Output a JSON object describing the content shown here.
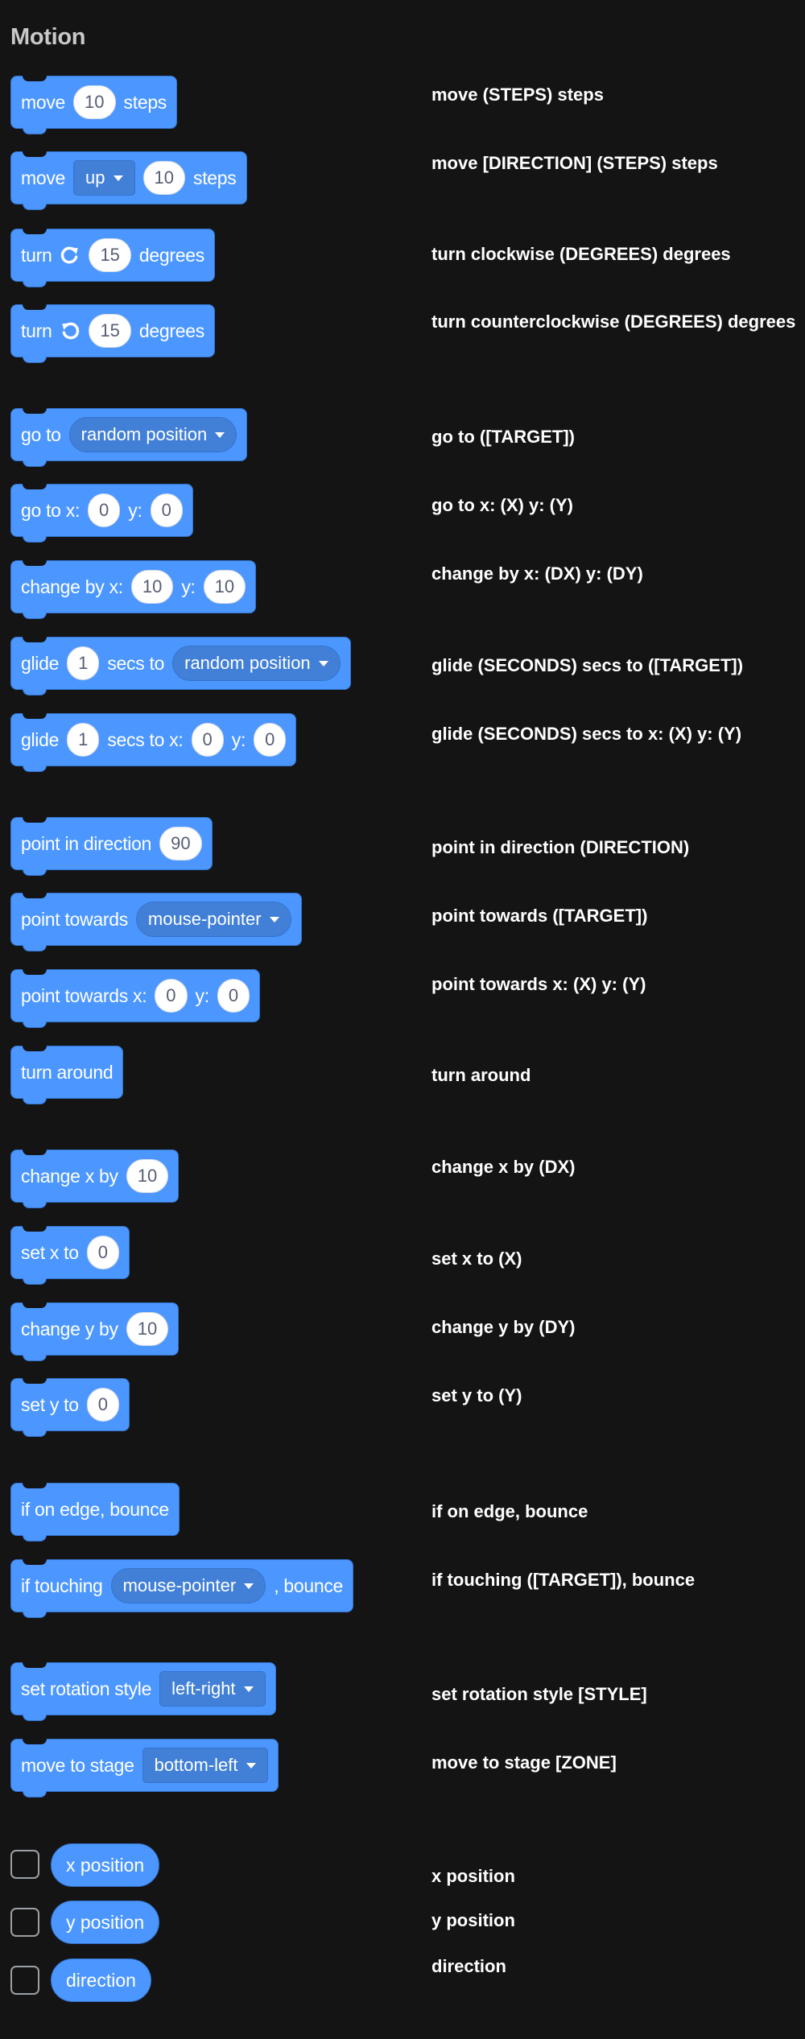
{
  "category_title": "Motion",
  "blocks": {
    "move_steps": {
      "pre": "move",
      "steps": "10",
      "post": "steps",
      "desc": "move (STEPS) steps"
    },
    "move_dir": {
      "pre": "move",
      "direction": "up",
      "steps": "10",
      "post": "steps",
      "desc": "move [DIRECTION] (STEPS) steps"
    },
    "turn_cw": {
      "pre": "turn",
      "degrees": "15",
      "post": "degrees",
      "desc": "turn clockwise (DEGREES) degrees"
    },
    "turn_ccw": {
      "pre": "turn",
      "degrees": "15",
      "post": "degrees",
      "desc": "turn counterclockwise (DEGREES) degrees"
    },
    "goto": {
      "pre": "go to",
      "target": "random position",
      "desc": "go to ([TARGET])"
    },
    "goto_xy": {
      "pre": "go to x:",
      "x": "0",
      "ylab": "y:",
      "y": "0",
      "desc": "go to x: (X) y: (Y)"
    },
    "change_by": {
      "pre": "change by x:",
      "dx": "10",
      "ylab": "y:",
      "dy": "10",
      "desc": "change by x: (DX) y: (DY)"
    },
    "glide_target": {
      "pre": "glide",
      "secs": "1",
      "mid": "secs to",
      "target": "random position",
      "desc": "glide (SECONDS) secs to ([TARGET])"
    },
    "glide_xy": {
      "pre": "glide",
      "secs": "1",
      "mid": "secs to x:",
      "x": "0",
      "ylab": "y:",
      "y": "0",
      "desc": "glide (SECONDS) secs to x: (X) y: (Y)"
    },
    "point_dir": {
      "pre": "point in direction",
      "direction": "90",
      "desc": "point in direction (DIRECTION)"
    },
    "point_towards": {
      "pre": "point towards",
      "target": "mouse-pointer",
      "desc": "point towards ([TARGET])"
    },
    "point_towards_xy": {
      "pre": "point towards x:",
      "x": "0",
      "ylab": "y:",
      "y": "0",
      "desc": "point towards x: (X) y: (Y)"
    },
    "turn_around": {
      "pre": "turn around",
      "desc": "turn around"
    },
    "change_x": {
      "pre": "change x by",
      "dx": "10",
      "desc": "change x by (DX)"
    },
    "set_x": {
      "pre": "set x to",
      "x": "0",
      "desc": "set x to (X)"
    },
    "change_y": {
      "pre": "change y by",
      "dy": "10",
      "desc": "change y by (DY)"
    },
    "set_y": {
      "pre": "set y to",
      "y": "0",
      "desc": "set y to (Y)"
    },
    "edge_bounce": {
      "pre": "if on edge, bounce",
      "desc": "if on edge, bounce"
    },
    "touch_bounce": {
      "pre": "if touching",
      "target": "mouse-pointer",
      "post": ", bounce",
      "desc": "if touching ([TARGET]), bounce"
    },
    "rot_style": {
      "pre": "set rotation style",
      "style": "left-right",
      "desc": "set rotation style [STYLE]"
    },
    "move_stage": {
      "pre": "move to stage",
      "zone": "bottom-left",
      "desc": "move to stage [ZONE]"
    }
  },
  "reporters": {
    "x_position": {
      "label": "x position",
      "desc": "x position"
    },
    "y_position": {
      "label": "y position",
      "desc": "y position"
    },
    "direction": {
      "label": "direction",
      "desc": "direction"
    }
  },
  "colors": {
    "block": "#4c97ff",
    "block_border": "#3373cc",
    "background": "#141414"
  }
}
